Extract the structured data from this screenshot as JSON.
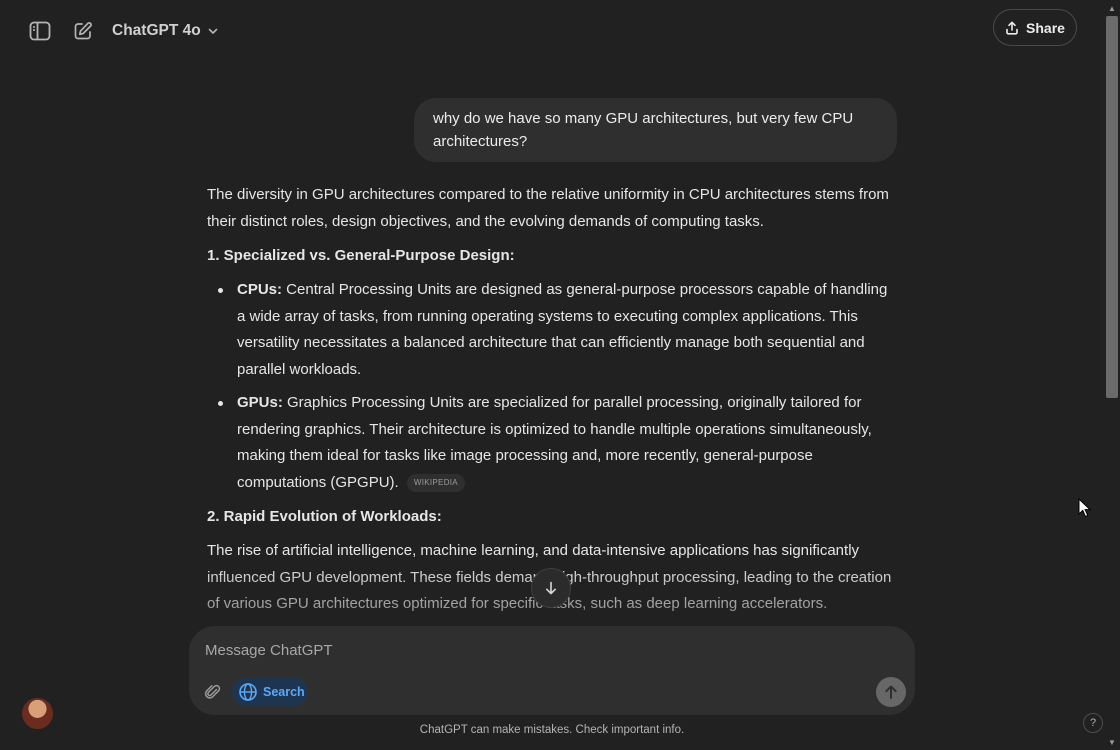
{
  "header": {
    "model_name": "ChatGPT 4o",
    "share_label": "Share"
  },
  "conversation": {
    "user_message": "why do we have so many GPU architectures, but very few CPU architectures?",
    "assistant": {
      "intro": "The diversity in GPU architectures compared to the relative uniformity in CPU architectures stems from their distinct roles, design objectives, and the evolving demands of computing tasks.",
      "section1_heading": "1. Specialized vs. General-Purpose Design:",
      "bullets": [
        {
          "term": "CPUs:",
          "text": " Central Processing Units are designed as general-purpose processors capable of handling a wide array of tasks, from running operating systems to executing complex applications. This versatility necessitates a balanced architecture that can efficiently manage both sequential and parallel workloads."
        },
        {
          "term": "GPUs:",
          "text": " Graphics Processing Units are specialized for parallel processing, originally tailored for rendering graphics. Their architecture is optimized to handle multiple operations simultaneously, making them ideal for tasks like image processing and, more recently, general-purpose computations (GPGPU).",
          "source": "WIKIPEDIA"
        }
      ],
      "section2_heading": "2. Rapid Evolution of Workloads:",
      "section2_text": "The rise of artificial intelligence, machine learning, and data-intensive applications has significantly influenced GPU development. These fields demand high-throughput processing, leading to the creation of various GPU architectures optimized for specific tasks, such as deep learning accelerators."
    }
  },
  "composer": {
    "placeholder": "Message ChatGPT",
    "search_label": "Search"
  },
  "footer": {
    "disclaimer": "ChatGPT can make mistakes. Check important info.",
    "help_label": "?"
  },
  "colors": {
    "background": "#212121",
    "bubble": "#2f2f2f",
    "search_accent": "#5ea9f5"
  }
}
